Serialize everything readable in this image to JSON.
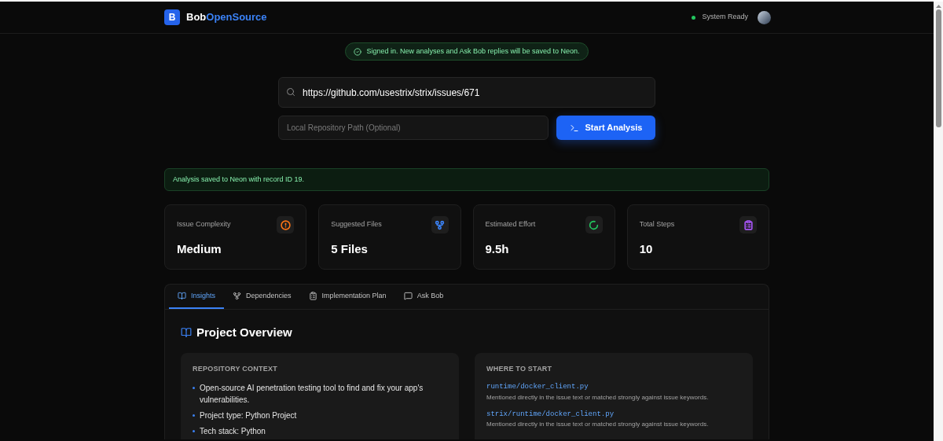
{
  "header": {
    "logo_letter": "B",
    "brand_first": "Bob",
    "brand_second": "OpenSource",
    "status": {
      "text": "System Ready",
      "color": "#22c55e"
    }
  },
  "signed_in_banner": "Signed in. New analyses and Ask Bob replies will be saved to Neon.",
  "url_field": {
    "value": "https://github.com/usestrix/strix/issues/671"
  },
  "path_field": {
    "placeholder": "Local Repository Path (Optional)"
  },
  "start_button": "Start Analysis",
  "saved_banner": "Analysis saved to Neon with record ID 19.",
  "stats": [
    {
      "label": "Issue Complexity",
      "value": "Medium",
      "kind": "alert",
      "color": "#f97316"
    },
    {
      "label": "Suggested Files",
      "value": "5 Files",
      "kind": "branch",
      "color": "#3b82f6"
    },
    {
      "label": "Estimated Effort",
      "value": "9.5h",
      "kind": "progress",
      "color": "#22c55e"
    },
    {
      "label": "Total Steps",
      "value": "10",
      "kind": "clipboard",
      "color": "#a855f7"
    }
  ],
  "tabs": [
    {
      "label": "Insights",
      "kind": "book",
      "selected": true
    },
    {
      "label": "Dependencies",
      "kind": "branch",
      "selected": false
    },
    {
      "label": "Implementation Plan",
      "kind": "clipboard",
      "selected": false
    },
    {
      "label": "Ask Bob",
      "kind": "chat",
      "selected": false
    }
  ],
  "section_title": "Project Overview",
  "repository_context": {
    "title": "REPOSITORY CONTEXT",
    "items": [
      "Open-source AI penetration testing tool to find and fix your app's vulnerabilities.",
      "Project type: Python Project",
      "Tech stack: Python"
    ]
  },
  "where_to_start": {
    "title": "WHERE TO START",
    "files": [
      {
        "path": "runtime/docker_client.py",
        "reason": "Mentioned directly in the issue text or matched strongly against issue keywords."
      },
      {
        "path": "strix/runtime/docker_client.py",
        "reason": "Mentioned directly in the issue text or matched strongly against issue keywords."
      }
    ]
  }
}
